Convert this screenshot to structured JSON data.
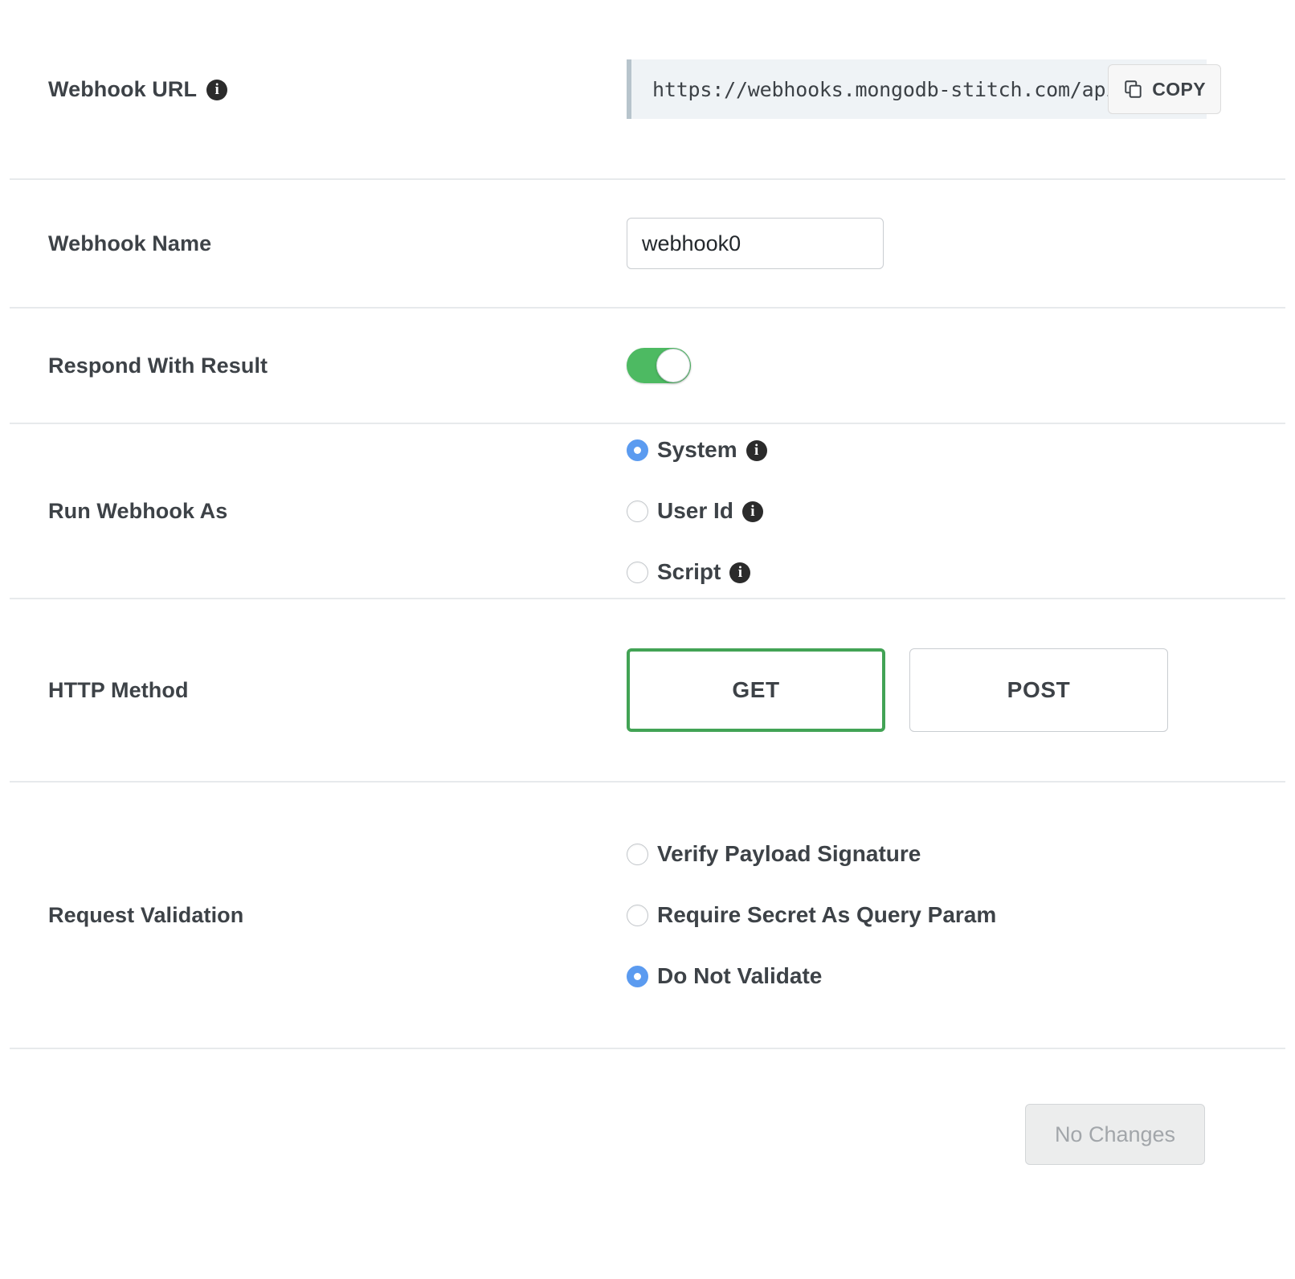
{
  "form": {
    "webhook_url": {
      "label": "Webhook URL",
      "info_icon": "info-icon",
      "value": "https://webhooks.mongodb-stitch.com/api/c",
      "copy_label": "COPY",
      "copy_icon": "copy-icon"
    },
    "webhook_name": {
      "label": "Webhook Name",
      "value": "webhook0"
    },
    "respond_with_result": {
      "label": "Respond With Result",
      "enabled": "on",
      "toggle_color": "#4dba62"
    },
    "run_webhook_as": {
      "label": "Run Webhook As",
      "options": [
        {
          "label": "System",
          "selected": true,
          "info_icon": "info-icon"
        },
        {
          "label": "User Id",
          "selected": false,
          "info_icon": "info-icon"
        },
        {
          "label": "Script",
          "selected": false,
          "info_icon": "info-icon"
        }
      ],
      "selected_color": "#5b9bf0"
    },
    "http_method": {
      "label": "HTTP Method",
      "options": [
        {
          "label": "GET",
          "selected": true
        },
        {
          "label": "POST",
          "selected": false
        }
      ],
      "selected_color": "#42a355"
    },
    "request_validation": {
      "label": "Request Validation",
      "options": [
        {
          "label": "Verify Payload Signature",
          "selected": false
        },
        {
          "label": "Require Secret As Query Param",
          "selected": false
        },
        {
          "label": "Do Not Validate",
          "selected": true
        }
      ],
      "selected_color": "#5b9bf0"
    }
  },
  "footer": {
    "save_label": "No Changes",
    "disabled": true
  }
}
